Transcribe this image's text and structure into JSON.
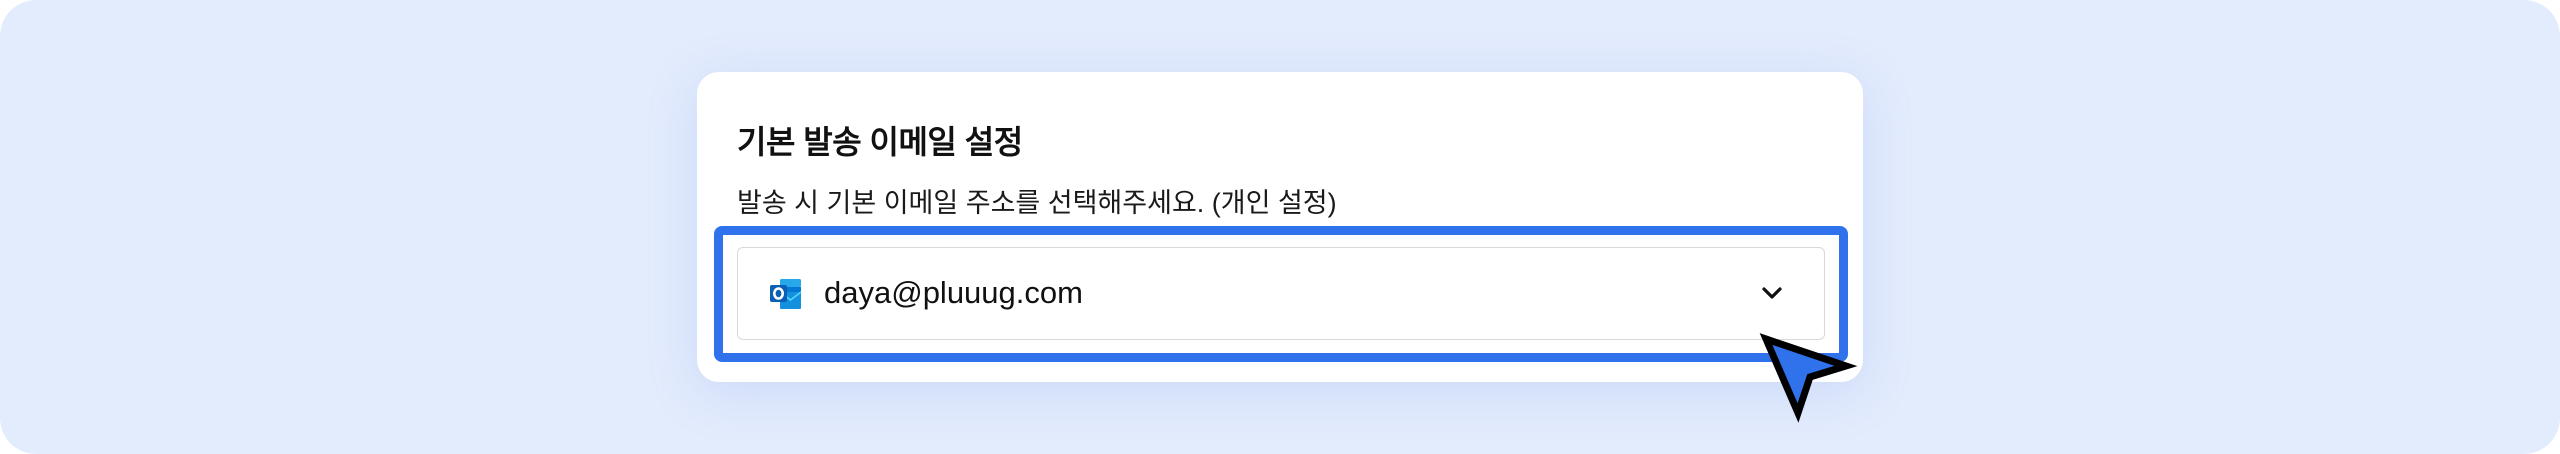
{
  "settings_card": {
    "title": "기본 발송 이메일 설정",
    "description": "발송 시 기본 이메일 주소를 선택해주세요. (개인 설정)"
  },
  "email_select": {
    "selected_value": "daya@pluuug.com",
    "icon": "outlook-icon",
    "dropdown_icon": "chevron-down-icon"
  },
  "overlay": {
    "highlight_color": "#2f72eb",
    "cursor_icon": "pointer-cursor-icon",
    "cursor_color": "#2f72eb"
  },
  "theme": {
    "background": "#e3ecfd",
    "card_background": "#ffffff"
  }
}
